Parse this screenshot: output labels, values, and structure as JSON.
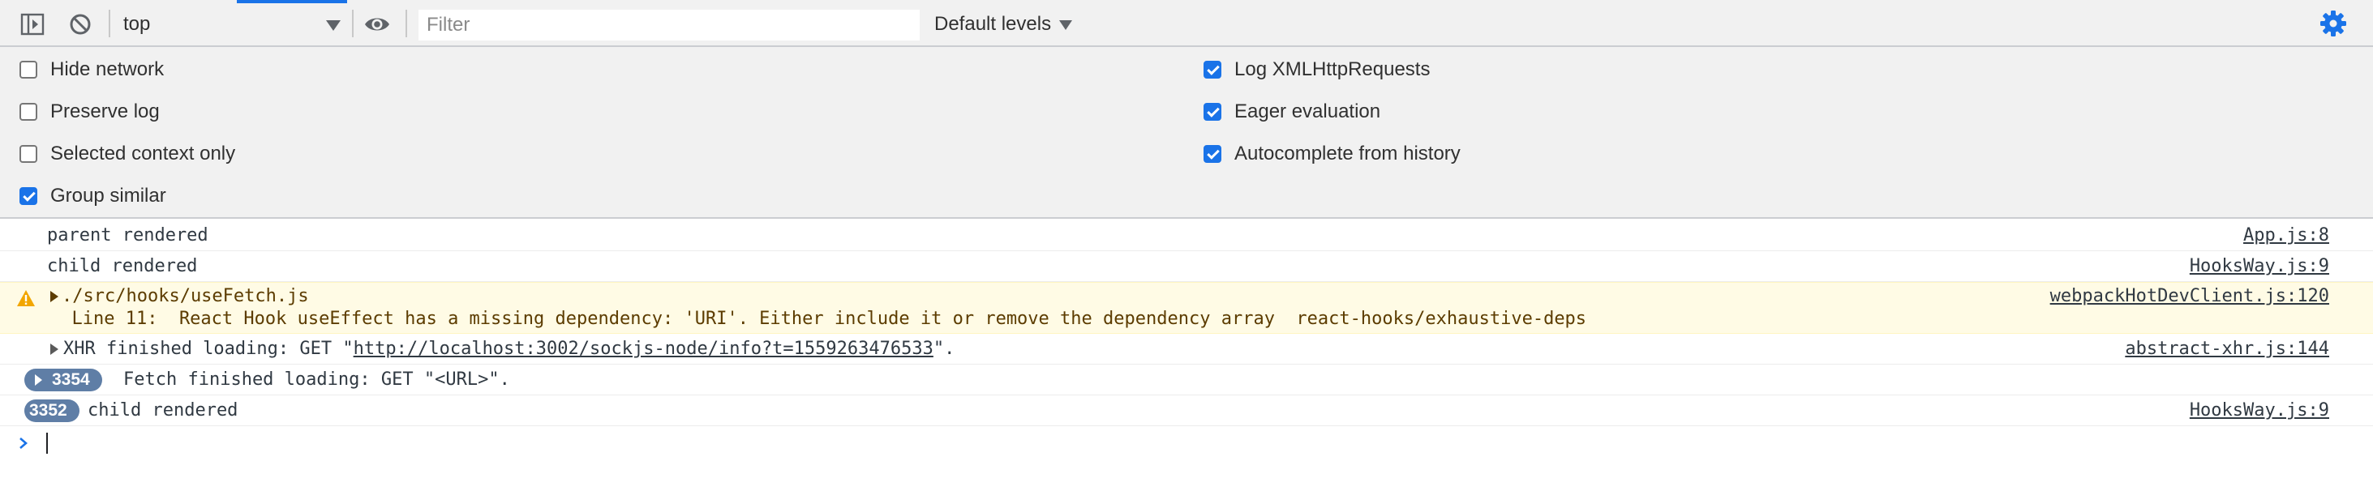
{
  "toolbar": {
    "sidebar_icon": "sidebar-toggle-icon",
    "clear_icon": "clear-console-icon",
    "context": "top",
    "eye_icon": "eye-icon",
    "filter_placeholder": "Filter",
    "filter_value": "",
    "levels_label": "Default levels",
    "settings_icon": "gear-icon",
    "accent": "#1a73e8"
  },
  "settings": {
    "left": [
      {
        "label": "Hide network",
        "checked": false
      },
      {
        "label": "Preserve log",
        "checked": false
      },
      {
        "label": "Selected context only",
        "checked": false
      },
      {
        "label": "Group similar",
        "checked": true
      }
    ],
    "right": [
      {
        "label": "Log XMLHttpRequests",
        "checked": true
      },
      {
        "label": "Eager evaluation",
        "checked": true
      },
      {
        "label": "Autocomplete from history",
        "checked": true
      }
    ]
  },
  "console": {
    "messages": [
      {
        "text": "parent rendered",
        "source": "App.js:8"
      },
      {
        "text": "child rendered",
        "source": "HooksWay.js:9"
      },
      {
        "level": "warning",
        "warning_icon": "warning-icon",
        "path": "./src/hooks/useFetch.js",
        "detail": "  Line 11:  React Hook useEffect has a missing dependency: 'URI'. Either include it or remove the dependency array  react-hooks/exhaustive-deps",
        "source": "webpackHotDevClient.js:120"
      },
      {
        "prefix": "XHR finished loading: GET \"",
        "url": "http://localhost:3002/sockjs-node/info?t=1559263476533",
        "suffix": "\".",
        "source": "abstract-xhr.js:144"
      },
      {
        "count": "3354",
        "text": "Fetch finished loading: GET \"<URL>\"."
      },
      {
        "count": "3352",
        "text": "child rendered",
        "source": "HooksWay.js:9"
      }
    ],
    "prompt_icon": "prompt-chevron-icon",
    "badge_color": "#5f7ea6",
    "warning_background": "#fffbe5",
    "warning_icon_color": "#f2a600"
  }
}
